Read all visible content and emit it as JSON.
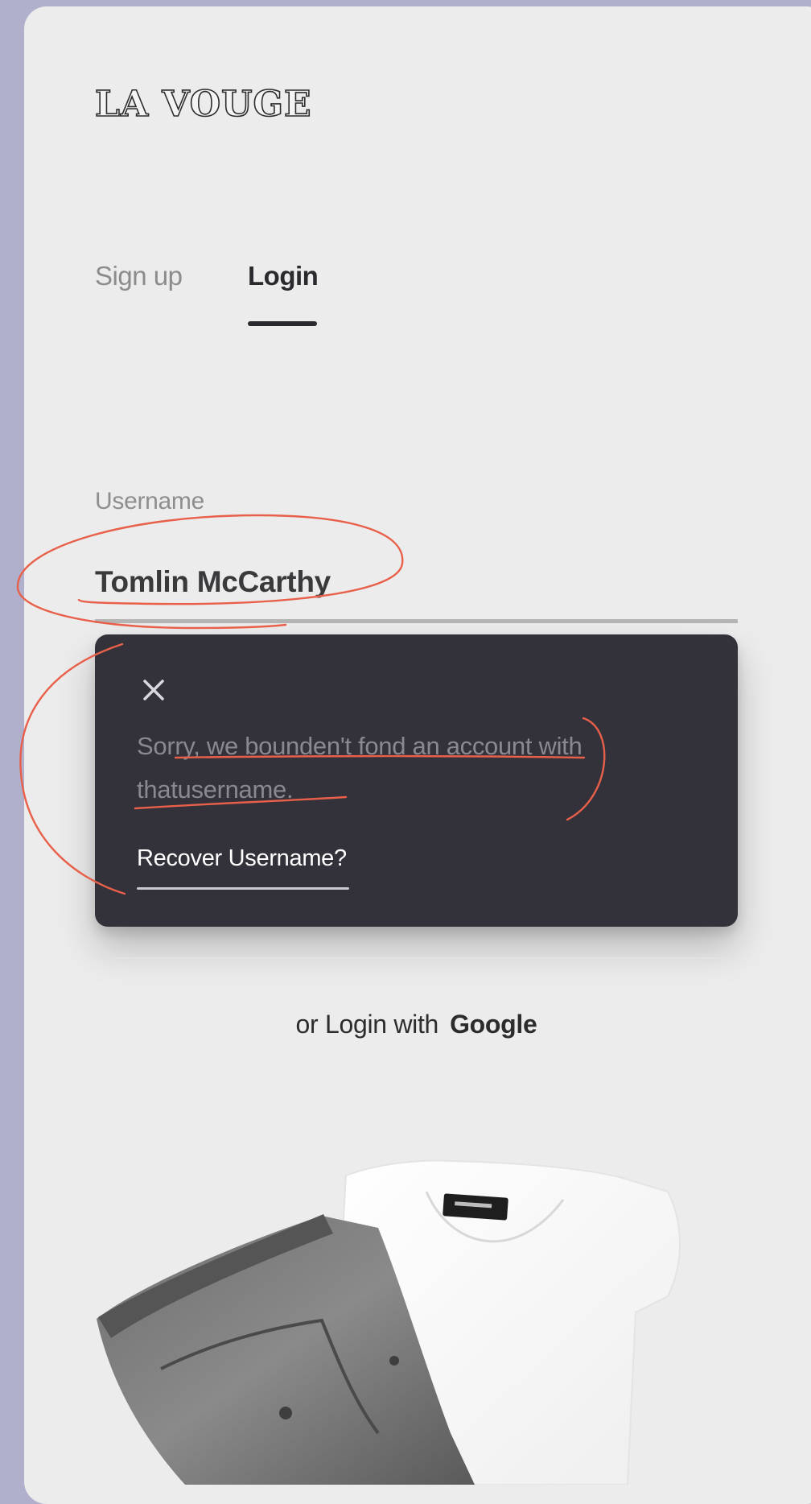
{
  "brand": {
    "logo_text": "LA VOUGE"
  },
  "tabs": [
    {
      "label": "Sign up",
      "active": false
    },
    {
      "label": "Login",
      "active": true
    }
  ],
  "login_form": {
    "username_label": "Username",
    "username_value": "Tomlin McCarthy"
  },
  "error_popover": {
    "close_icon": "close-icon",
    "message": "Sorry, we bounden't fond an account with thatusername.",
    "recover_link": "Recover Username?"
  },
  "social_login": {
    "prefix": "or Login with",
    "provider": "Google"
  },
  "colors": {
    "page_background": "#b0b0cd",
    "card_background": "#ececec",
    "popover_background": "#33313a",
    "annotation_stroke": "#e8604a",
    "text_dark": "#2a2a2e"
  }
}
